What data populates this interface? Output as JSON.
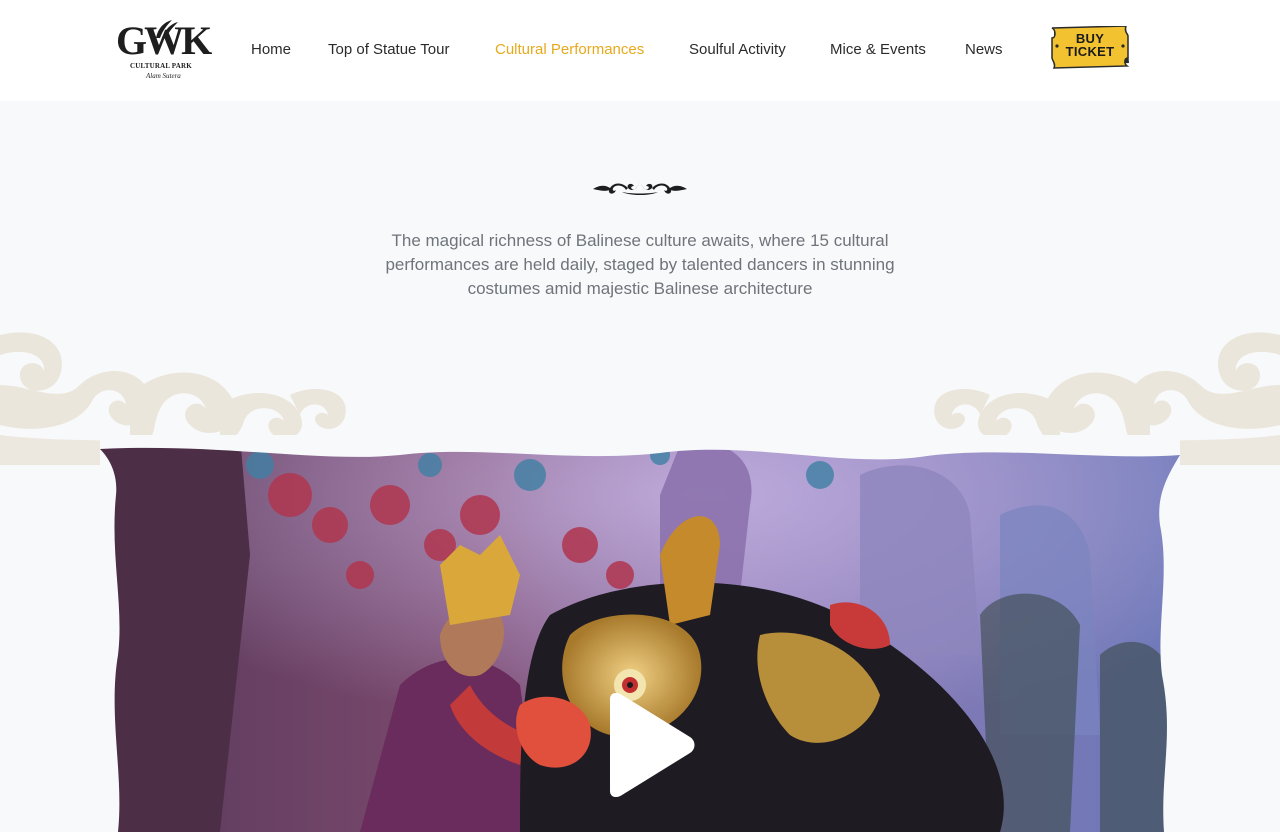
{
  "brand": {
    "logo_text": "GWK",
    "logo_subtitle": "CULTURAL PARK",
    "logo_script": "Alam Sutera"
  },
  "nav": {
    "items": [
      {
        "label": "Home",
        "active": false
      },
      {
        "label": "Top of Statue Tour",
        "active": false
      },
      {
        "label": "Cultural Performances",
        "active": true
      },
      {
        "label": "Soulful Activity",
        "active": false
      },
      {
        "label": "Mice & Events",
        "active": false
      },
      {
        "label": "News",
        "active": false
      }
    ],
    "ticket": {
      "line1": "BUY",
      "line2": "TICKET"
    }
  },
  "intro": {
    "text": "The magical richness of Balinese culture awaits, where 15 cultural performances are held daily, staged by talented dancers in stunning costumes amid majestic Balinese architecture"
  },
  "video": {
    "play_icon": "play-icon"
  },
  "colors": {
    "accent": "#e8a91c",
    "ticket_fill": "#f2c230",
    "nav_text": "#2b2b2b",
    "body_text": "#6f747a",
    "page_bg": "#f8f9fb",
    "cloud": "#ebe6dc"
  }
}
